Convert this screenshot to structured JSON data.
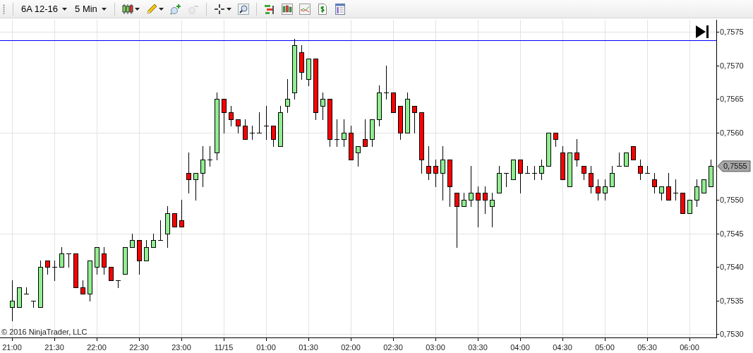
{
  "toolbar": {
    "instrument": "6A 12-16",
    "interval": "5 Min",
    "tool_groups": [
      [
        {
          "kind": "chart-style",
          "dropdown": true,
          "disabled": false
        },
        {
          "kind": "drawing",
          "dropdown": true,
          "disabled": false
        },
        {
          "kind": "zoom-in",
          "dropdown": false,
          "disabled": false
        },
        {
          "kind": "zoom-out",
          "dropdown": false,
          "disabled": true
        }
      ],
      [
        {
          "kind": "crosshair",
          "dropdown": true,
          "disabled": false
        },
        {
          "kind": "zoom-box",
          "dropdown": false,
          "disabled": false
        }
      ],
      [
        {
          "kind": "bars",
          "dropdown": false,
          "disabled": false
        },
        {
          "kind": "candles",
          "dropdown": false,
          "disabled": false
        },
        {
          "kind": "line-chart",
          "dropdown": false,
          "disabled": false
        },
        {
          "kind": "dollar",
          "dropdown": false,
          "disabled": false
        },
        {
          "kind": "panel",
          "dropdown": false,
          "disabled": false
        }
      ]
    ]
  },
  "chart": {
    "copyright": "© 2016 NinjaTrader, LLC",
    "chart_data": {
      "type": "candlestick",
      "grid": true,
      "categories": [
        "21:00",
        null,
        null,
        null,
        null,
        null,
        "21:30",
        null,
        null,
        null,
        null,
        null,
        "22:00",
        null,
        null,
        null,
        null,
        null,
        "22:30",
        null,
        null,
        null,
        null,
        null,
        "23:00",
        null,
        null,
        null,
        null,
        null,
        "11/15",
        null,
        null,
        null,
        null,
        null,
        "01:00",
        null,
        null,
        null,
        null,
        null,
        "01:30",
        null,
        null,
        null,
        null,
        null,
        "02:00",
        null,
        null,
        null,
        null,
        null,
        "02:30",
        null,
        null,
        null,
        null,
        null,
        "03:00",
        null,
        null,
        null,
        null,
        null,
        "03:30",
        null,
        null,
        null,
        null,
        null,
        "04:00",
        null,
        null,
        null,
        null,
        null,
        "04:30",
        null,
        null,
        null,
        null,
        null,
        "05:00",
        null,
        null,
        null,
        null,
        null,
        "05:30",
        null,
        null,
        null,
        null,
        null,
        "06:00",
        null,
        null,
        null
      ],
      "ohlc": [
        [
          0.7534,
          0.7538,
          0.7532,
          0.7535
        ],
        [
          0.7534,
          0.7537,
          0.7534,
          0.7537
        ],
        [
          0.7536,
          0.7537,
          0.7536,
          0.7536
        ],
        [
          0.7535,
          0.7535,
          0.7534,
          0.7535
        ],
        [
          0.7534,
          0.7541,
          0.7534,
          0.754
        ],
        [
          0.7541,
          0.7541,
          0.7539,
          0.754
        ],
        [
          0.754,
          0.7541,
          0.7538,
          0.754
        ],
        [
          0.754,
          0.7543,
          0.754,
          0.7542
        ],
        [
          0.7542,
          0.7542,
          0.754,
          0.7542
        ],
        [
          0.7542,
          0.7542,
          0.7537,
          0.7537
        ],
        [
          0.7537,
          0.7538,
          0.7536,
          0.7536
        ],
        [
          0.7536,
          0.7541,
          0.7535,
          0.7541
        ],
        [
          0.754,
          0.7543,
          0.7539,
          0.7543
        ],
        [
          0.7542,
          0.7543,
          0.7539,
          0.754
        ],
        [
          0.754,
          0.754,
          0.7538,
          0.7538
        ],
        [
          0.7538,
          0.7538,
          0.7537,
          0.7538
        ],
        [
          0.7539,
          0.7543,
          0.7539,
          0.7543
        ],
        [
          0.7543,
          0.7545,
          0.7543,
          0.7544
        ],
        [
          0.7544,
          0.7544,
          0.7539,
          0.7541
        ],
        [
          0.7541,
          0.7544,
          0.7541,
          0.7543
        ],
        [
          0.7543,
          0.7545,
          0.7543,
          0.7544
        ],
        [
          0.7544,
          0.7547,
          0.7544,
          0.7544
        ],
        [
          0.7545,
          0.7549,
          0.7543,
          0.7548
        ],
        [
          0.7548,
          0.7548,
          0.7546,
          0.7546
        ],
        [
          0.7547,
          0.755,
          0.7546,
          0.7546
        ],
        [
          0.7554,
          0.7557,
          0.7551,
          0.7553
        ],
        [
          0.7553,
          0.7554,
          0.755,
          0.7554
        ],
        [
          0.7554,
          0.7558,
          0.7552,
          0.7556
        ],
        [
          0.7556,
          0.7558,
          0.7555,
          0.7556
        ],
        [
          0.7557,
          0.7566,
          0.7556,
          0.7565
        ],
        [
          0.7565,
          0.7565,
          0.756,
          0.7563
        ],
        [
          0.7563,
          0.7564,
          0.7561,
          0.7562
        ],
        [
          0.7562,
          0.7562,
          0.756,
          0.7561
        ],
        [
          0.7561,
          0.7562,
          0.7559,
          0.7559
        ],
        [
          0.756,
          0.7561,
          0.7559,
          0.756
        ],
        [
          0.756,
          0.7563,
          0.756,
          0.756
        ],
        [
          0.7561,
          0.7564,
          0.7559,
          0.7561
        ],
        [
          0.7561,
          0.7561,
          0.7558,
          0.7559
        ],
        [
          0.7558,
          0.7564,
          0.7558,
          0.7563
        ],
        [
          0.7564,
          0.7568,
          0.7563,
          0.7565
        ],
        [
          0.7566,
          0.7574,
          0.7565,
          0.7573
        ],
        [
          0.7572,
          0.7573,
          0.7568,
          0.7569
        ],
        [
          0.7568,
          0.7571,
          0.7567,
          0.7571
        ],
        [
          0.7571,
          0.7571,
          0.7562,
          0.7563
        ],
        [
          0.7564,
          0.7566,
          0.7562,
          0.7565
        ],
        [
          0.7565,
          0.7565,
          0.7558,
          0.7559
        ],
        [
          0.7559,
          0.7562,
          0.7558,
          0.7559
        ],
        [
          0.7559,
          0.7562,
          0.7558,
          0.756
        ],
        [
          0.756,
          0.7561,
          0.7556,
          0.7556
        ],
        [
          0.7557,
          0.7558,
          0.7555,
          0.7558
        ],
        [
          0.7559,
          0.7562,
          0.7558,
          0.7558
        ],
        [
          0.7559,
          0.7562,
          0.7558,
          0.7562
        ],
        [
          0.7562,
          0.7567,
          0.7561,
          0.7566
        ],
        [
          0.7566,
          0.757,
          0.7565,
          0.7566
        ],
        [
          0.7566,
          0.7566,
          0.7563,
          0.7563
        ],
        [
          0.7564,
          0.7564,
          0.7559,
          0.756
        ],
        [
          0.756,
          0.7566,
          0.756,
          0.7565
        ],
        [
          0.7564,
          0.7564,
          0.756,
          0.7563
        ],
        [
          0.7563,
          0.7563,
          0.7554,
          0.7556
        ],
        [
          0.7555,
          0.7558,
          0.7553,
          0.7554
        ],
        [
          0.7555,
          0.7556,
          0.7552,
          0.7554
        ],
        [
          0.7554,
          0.7558,
          0.755,
          0.7556
        ],
        [
          0.7556,
          0.7556,
          0.7549,
          0.7552
        ],
        [
          0.7551,
          0.7551,
          0.7543,
          0.7549
        ],
        [
          0.7549,
          0.7551,
          0.7549,
          0.755
        ],
        [
          0.755,
          0.7555,
          0.7549,
          0.7551
        ],
        [
          0.7551,
          0.7552,
          0.7546,
          0.755
        ],
        [
          0.7551,
          0.7552,
          0.7548,
          0.755
        ],
        [
          0.7549,
          0.7551,
          0.7546,
          0.755
        ],
        [
          0.7551,
          0.7555,
          0.7551,
          0.7554
        ],
        [
          0.7554,
          0.7554,
          0.7552,
          0.7554
        ],
        [
          0.7553,
          0.7556,
          0.7553,
          0.7556
        ],
        [
          0.7556,
          0.7556,
          0.7551,
          0.7554
        ],
        [
          0.7554,
          0.7555,
          0.7554,
          0.7554
        ],
        [
          0.7554,
          0.7555,
          0.7553,
          0.7554
        ],
        [
          0.7554,
          0.7556,
          0.7553,
          0.7555
        ],
        [
          0.7555,
          0.756,
          0.7555,
          0.756
        ],
        [
          0.756,
          0.756,
          0.7558,
          0.7559
        ],
        [
          0.7557,
          0.7558,
          0.7553,
          0.7553
        ],
        [
          0.7552,
          0.7557,
          0.7552,
          0.7557
        ],
        [
          0.7557,
          0.7559,
          0.7555,
          0.7556
        ],
        [
          0.7555,
          0.7555,
          0.7553,
          0.7554
        ],
        [
          0.7554,
          0.7555,
          0.7551,
          0.7552
        ],
        [
          0.7552,
          0.7553,
          0.755,
          0.7551
        ],
        [
          0.7551,
          0.7553,
          0.755,
          0.7552
        ],
        [
          0.7552,
          0.7555,
          0.7552,
          0.7554
        ],
        [
          0.7555,
          0.7557,
          0.7555,
          0.7555
        ],
        [
          0.7555,
          0.7557,
          0.7555,
          0.7557
        ],
        [
          0.7558,
          0.7558,
          0.7556,
          0.7556
        ],
        [
          0.7555,
          0.7556,
          0.7553,
          0.7554
        ],
        [
          0.7554,
          0.7555,
          0.7554,
          0.7554
        ],
        [
          0.7553,
          0.7554,
          0.7551,
          0.7552
        ],
        [
          0.7551,
          0.7552,
          0.755,
          0.7552
        ],
        [
          0.7552,
          0.7554,
          0.755,
          0.755
        ],
        [
          0.7551,
          0.7553,
          0.755,
          0.7551
        ],
        [
          0.7551,
          0.7551,
          0.7548,
          0.7548
        ],
        [
          0.7548,
          0.755,
          0.7548,
          0.755
        ],
        [
          0.755,
          0.7553,
          0.7549,
          0.7552
        ],
        [
          0.7551,
          0.7553,
          0.7551,
          0.7553
        ],
        [
          0.7552,
          0.7556,
          0.7552,
          0.7555
        ]
      ],
      "ylim": [
        0.75295,
        0.75768
      ],
      "yticks": [
        {
          "value": 0.753,
          "label": "0,7530"
        },
        {
          "value": 0.7535,
          "label": "0,7535"
        },
        {
          "value": 0.754,
          "label": "0,7540"
        },
        {
          "value": 0.7545,
          "label": "0,7545"
        },
        {
          "value": 0.755,
          "label": "0,7550"
        },
        {
          "value": 0.756,
          "label": "0,7560"
        },
        {
          "value": 0.7565,
          "label": "0,7565"
        },
        {
          "value": 0.757,
          "label": "0,7570"
        },
        {
          "value": 0.7575,
          "label": "0,7575"
        }
      ],
      "ref_lines": [
        {
          "axis": "y",
          "value": 0.75738,
          "color": "#0000ff"
        }
      ],
      "annotations": [
        "0,7555"
      ]
    }
  }
}
